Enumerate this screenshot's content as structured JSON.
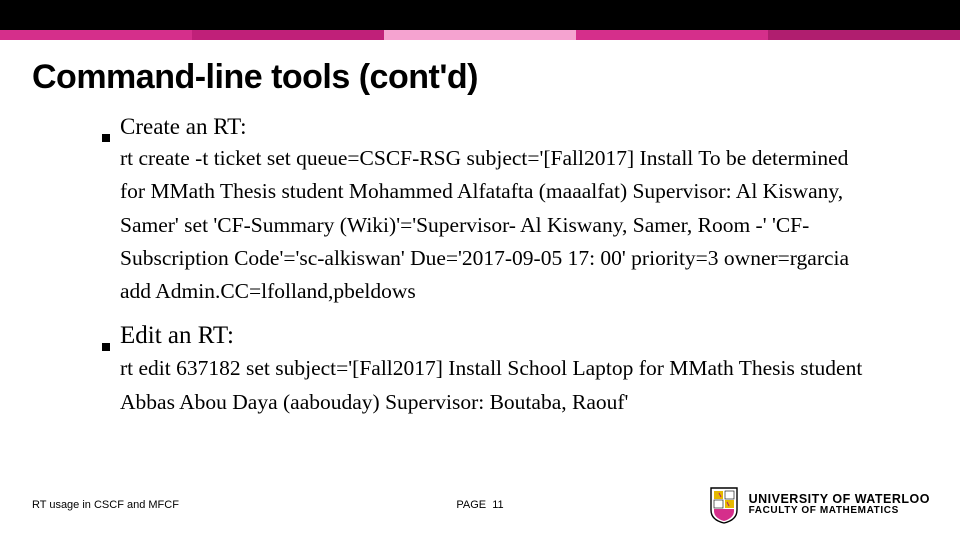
{
  "stripe_colors": [
    "#d52f8b",
    "#c02079",
    "#f5a3d0",
    "#d52f8b",
    "#b01e6f"
  ],
  "title": "Command-line tools (cont'd)",
  "items": [
    {
      "head": "Create an RT:",
      "head_class": "head1",
      "body": "rt create -t ticket set queue=CSCF-RSG subject='[Fall2017] Install To be determined for MMath Thesis student Mohammed Alfatafta (maaalfat) Supervisor: Al Kiswany, Samer' set 'CF-Summary (Wiki)'='Supervisor- Al Kiswany, Samer, Room -' 'CF-Subscription Code'='sc-alkiswan' Due='2017-09-05 17: 00' priority=3 owner=rgarcia add Admin.CC=lfolland,pbeldows"
    },
    {
      "head": "Edit an RT:",
      "head_class": "head2",
      "body": "rt edit 637182 set subject='[Fall2017] Install School Laptop for MMath Thesis student Abbas Abou Daya (aabouday) Supervisor: Boutaba, Raouf'"
    }
  ],
  "footer": {
    "left": "RT usage in CSCF and MFCF",
    "page_label": "PAGE",
    "page_num": "11",
    "uw_line1": "UNIVERSITY OF WATERLOO",
    "uw_line2": "FACULTY OF MATHEMATICS"
  }
}
